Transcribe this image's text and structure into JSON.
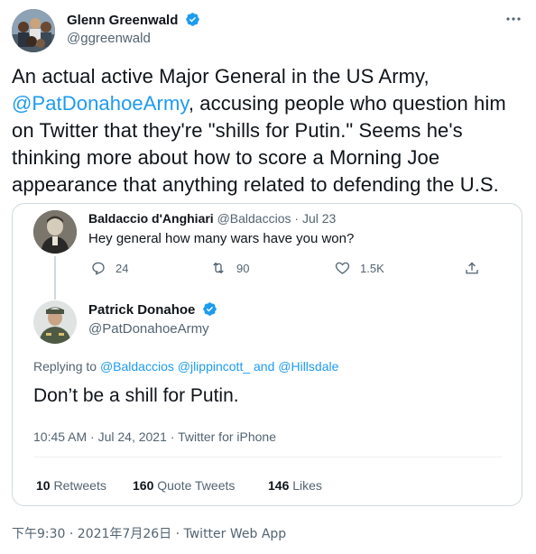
{
  "author": {
    "display_name": "Glenn Greenwald",
    "handle": "@ggreenwald"
  },
  "tweet": {
    "text_line1": "An actual active Major General in the US Army,",
    "mention": "@PatDonahoeArmy",
    "text_line2_rest": ", accusing people who question him",
    "text_line3": "on Twitter that they're \"shills for Putin.\" Seems he's",
    "text_line4": "thinking more about how to score a Morning Joe",
    "text_line5": "appearance that anything related to defending the U.S.",
    "timestamp": "下午9:30 · 2021年7月26日 · Twitter Web App"
  },
  "embedded": {
    "reply": {
      "display_name": "Baldaccio d'Anghiari",
      "handle": "@Baldaccios",
      "date": "· Jul 23",
      "text": "Hey general how many wars have you won?",
      "replies": "24",
      "retweets": "90",
      "likes": "1.5K"
    },
    "main": {
      "display_name": "Patrick Donahoe",
      "handle": "@PatDonahoeArmy",
      "replying_to_label": "Replying to",
      "replying_to_1": "@Baldaccios",
      "replying_to_2": "@jlippincott_",
      "replying_and": "and",
      "replying_to_3": "@Hillsdale",
      "text": "Don’t be a shill for Putin.",
      "meta": "10:45 AM · Jul 24, 2021 · Twitter for iPhone",
      "retweets_count": "10",
      "retweets_label": "Retweets",
      "quotes_count": "160",
      "quotes_label": "Quote Tweets",
      "likes_count": "146",
      "likes_label": "Likes"
    }
  },
  "colors": {
    "accent": "#1d9bf0",
    "text": "#0f1419",
    "muted": "#536471",
    "border": "#cfd9de"
  },
  "icons": [
    "more-icon",
    "verified-badge-icon",
    "reply-icon",
    "retweet-icon",
    "like-icon",
    "share-icon"
  ]
}
